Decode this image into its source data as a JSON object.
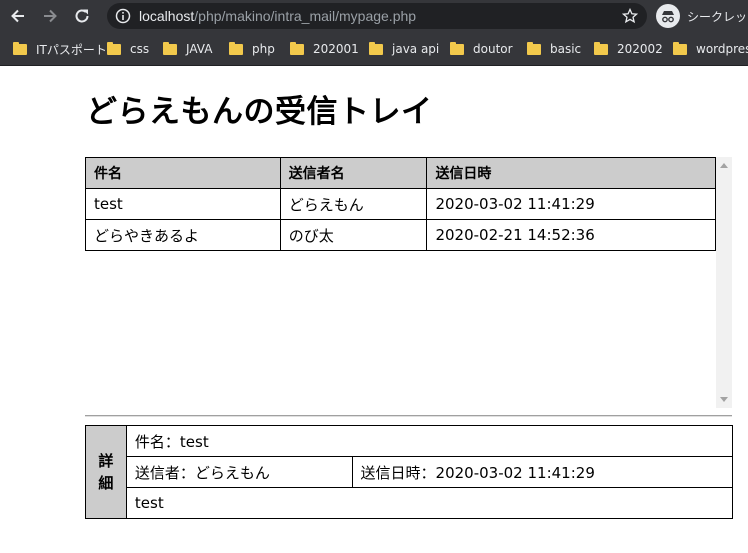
{
  "browser": {
    "url_host": "localhost",
    "url_path": "/php/makino/intra_mail/mypage.php",
    "incognito_label": "シークレット",
    "bookmarks": [
      {
        "label": "ITパスポート"
      },
      {
        "label": "css"
      },
      {
        "label": "JAVA"
      },
      {
        "label": "php"
      },
      {
        "label": "202001"
      },
      {
        "label": "java api"
      },
      {
        "label": "doutor"
      },
      {
        "label": "basic"
      },
      {
        "label": "202002"
      },
      {
        "label": "wordpress"
      }
    ]
  },
  "page": {
    "title": "どらえもんの受信トレイ"
  },
  "inbox": {
    "headers": [
      "件名",
      "送信者名",
      "送信日時"
    ],
    "rows": [
      {
        "subject": "test",
        "sender": "どらえもん",
        "date": "2020-03-02 11:41:29"
      },
      {
        "subject": "どらやきあるよ",
        "sender": "のび太",
        "date": "2020-02-21 14:52:36"
      }
    ]
  },
  "detail": {
    "heading": "詳細",
    "subject_line": "件名：test",
    "sender_line": "送信者：どらえもん",
    "date_line": "送信日時：2020-03-02 11:41:29",
    "body": "test"
  }
}
